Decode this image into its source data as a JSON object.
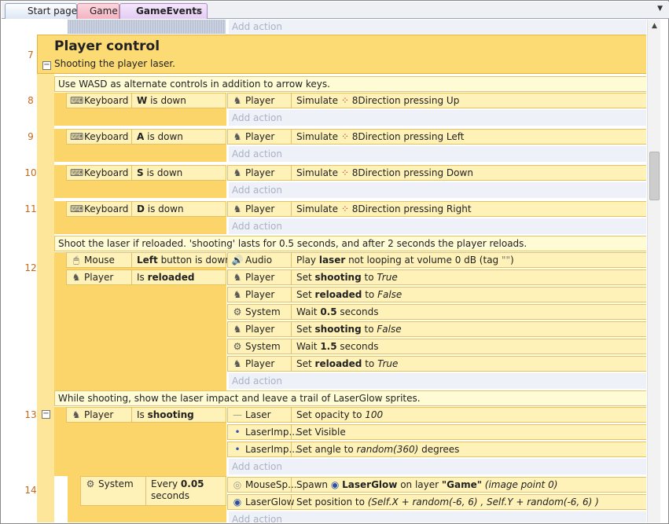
{
  "tabs": [
    {
      "label": "Start page"
    },
    {
      "label": "Game"
    },
    {
      "label": "GameEvents",
      "close": "×"
    }
  ],
  "tab_dropdown": "▼",
  "add_action_label": "Add action",
  "group": {
    "number": "7",
    "title": "Player control",
    "description": "Shooting the player laser.",
    "expander": "−"
  },
  "comments": {
    "c1": "Use WASD as alternate controls in addition to arrow keys.",
    "c2": "Shoot the laser if reloaded.  'shooting' lasts for 0.5 seconds, and after 2 seconds the player reloads.",
    "c3": "While shooting, show the laser impact and leave a trail of LaserGlow sprites."
  },
  "events": {
    "e8": {
      "num": "8",
      "cond_obj": "Keyboard",
      "cond_key": "W",
      "cond_rest": " is down",
      "act_obj": "Player",
      "act_pre": "Simulate ",
      "act_beh": "8Direction pressing Up"
    },
    "e9": {
      "num": "9",
      "cond_obj": "Keyboard",
      "cond_key": "A",
      "cond_rest": " is down",
      "act_obj": "Player",
      "act_pre": "Simulate ",
      "act_beh": "8Direction pressing Left"
    },
    "e10": {
      "num": "10",
      "cond_obj": "Keyboard",
      "cond_key": "S",
      "cond_rest": " is down",
      "act_obj": "Player",
      "act_pre": "Simulate ",
      "act_beh": "8Direction pressing Down"
    },
    "e11": {
      "num": "11",
      "cond_obj": "Keyboard",
      "cond_key": "D",
      "cond_rest": " is down",
      "act_obj": "Player",
      "act_pre": "Simulate ",
      "act_beh": "8Direction pressing Right"
    },
    "e12": {
      "num": "12",
      "cond1": {
        "obj": "Mouse",
        "b": "Left",
        "rest": " button is down"
      },
      "cond2": {
        "obj": "Player",
        "pre": "Is ",
        "b": "reloaded"
      },
      "a1": {
        "obj": "Audio",
        "pre": "Play ",
        "b": "laser",
        "rest": " not looping at volume 0 dB (tag ",
        "str": "\"\"",
        "end": ")"
      },
      "a2": {
        "obj": "Player",
        "pre": "Set ",
        "b": "shooting",
        "mid": " to ",
        "i": "True"
      },
      "a3": {
        "obj": "Player",
        "pre": "Set ",
        "b": "reloaded",
        "mid": " to ",
        "i": "False"
      },
      "a4": {
        "obj": "System",
        "pre": "Wait ",
        "b": "0.5",
        "rest": " seconds"
      },
      "a5": {
        "obj": "Player",
        "pre": "Set ",
        "b": "shooting",
        "mid": " to ",
        "i": "False"
      },
      "a6": {
        "obj": "System",
        "pre": "Wait ",
        "b": "1.5",
        "rest": " seconds"
      },
      "a7": {
        "obj": "Player",
        "pre": "Set ",
        "b": "reloaded",
        "mid": " to ",
        "i": "True"
      }
    },
    "e13": {
      "num": "13",
      "expander": "−",
      "cond": {
        "obj": "Player",
        "pre": "Is ",
        "b": "shooting"
      },
      "a1": {
        "obj": "Laser",
        "pre": "Set opacity to ",
        "i": "100"
      },
      "a2": {
        "obj": "LaserImp...",
        "txt": "Set Visible"
      },
      "a3": {
        "obj": "LaserImp...",
        "pre": "Set angle to ",
        "i": "random(360)",
        "rest": "  degrees"
      }
    },
    "e14": {
      "num": "14",
      "cond": {
        "obj": "System",
        "pre": "Every ",
        "b": "0.05",
        "rest": "seconds"
      },
      "a1": {
        "obj": "MouseSp...",
        "pre": "Spawn ",
        "b": "LaserGlow",
        "mid": " on layer ",
        "str": "\"Game\"",
        "i": " (image point 0)"
      },
      "a2": {
        "obj": "LaserGlow",
        "pre": "Set position to ",
        "i": "(Self.X + random(-6, 6)  , Self.Y + random(-6, 6)  )"
      }
    }
  },
  "icons": {
    "keyboard": "keyboard-icon",
    "player": "player-icon",
    "mouse": "mouse-icon",
    "audio": "speaker-icon",
    "system": "gear-icon",
    "behavior": "8direction-icon"
  },
  "colors": {
    "group": "#fcdb74",
    "event": "#fff2b8",
    "comment": "#fffbd4",
    "add_action": "#eef1f8",
    "event_number": "#c36a1c"
  }
}
